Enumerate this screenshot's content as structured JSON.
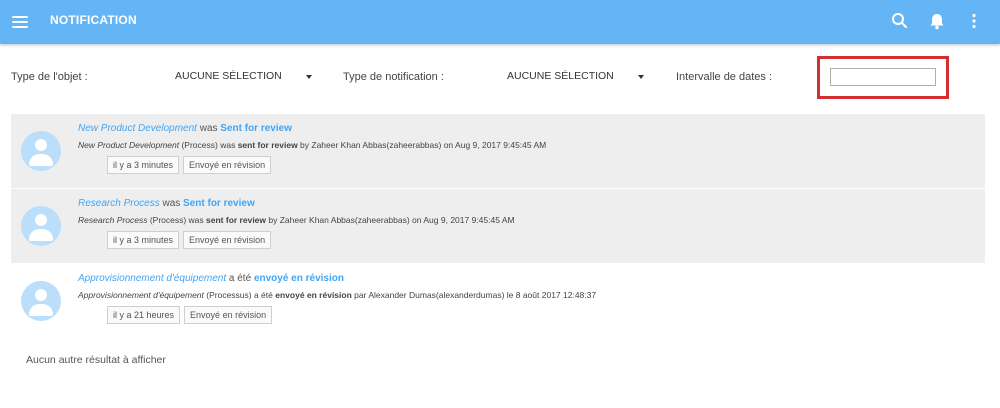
{
  "appbar": {
    "title": "NOTIFICATION",
    "icons": [
      "menu-icon",
      "search-icon",
      "bell-icon",
      "more-vertical-icon"
    ]
  },
  "filters": {
    "object_type_label": "Type de l'objet :",
    "object_type_value": "AUCUNE SÉLECTION",
    "notification_type_label": "Type de notification :",
    "notification_type_value": "AUCUNE SÉLECTION",
    "date_range_label": "Intervalle de dates :",
    "date_range_value": "",
    "highlight_color": "#d32f2f"
  },
  "notifications": [
    {
      "object": "New Product Development",
      "connector": " was ",
      "action": "Sent for review",
      "desc_object": "New Product Development",
      "desc_type": " (Process) was ",
      "desc_action": "sent for review",
      "desc_rest": " by Zaheer Khan Abbas(zaheerabbas) on Aug 9, 2017 9:45:45 AM",
      "time": "il y a 3 minutes",
      "status": "Envoyé en révision",
      "read": false
    },
    {
      "object": "Research Process",
      "connector": " was ",
      "action": "Sent for review",
      "desc_object": "Research Process",
      "desc_type": " (Process) was ",
      "desc_action": "sent for review",
      "desc_rest": " by Zaheer Khan Abbas(zaheerabbas) on Aug 9, 2017 9:45:45 AM",
      "time": "il y a 3 minutes",
      "status": "Envoyé en révision",
      "read": false
    },
    {
      "object": "Approvisionnement d'équipement",
      "connector": " a été ",
      "action": "envoyé en révision",
      "desc_object": "Approvisionnement d'équipement",
      "desc_type": " (Processus) a été ",
      "desc_action": "envoyé en révision",
      "desc_rest": " par Alexander Dumas(alexanderdumas) le 8 août 2017 12:48:37",
      "time": "il y a 21 heures",
      "status": "Envoyé en révision",
      "read": true
    }
  ],
  "footer": {
    "no_more_results": "Aucun autre résultat à afficher"
  },
  "colors": {
    "appbar": "#64b5f6",
    "link": "#42a5f5",
    "unread_bg": "#eeeeee",
    "avatar": "#bbdefb"
  }
}
